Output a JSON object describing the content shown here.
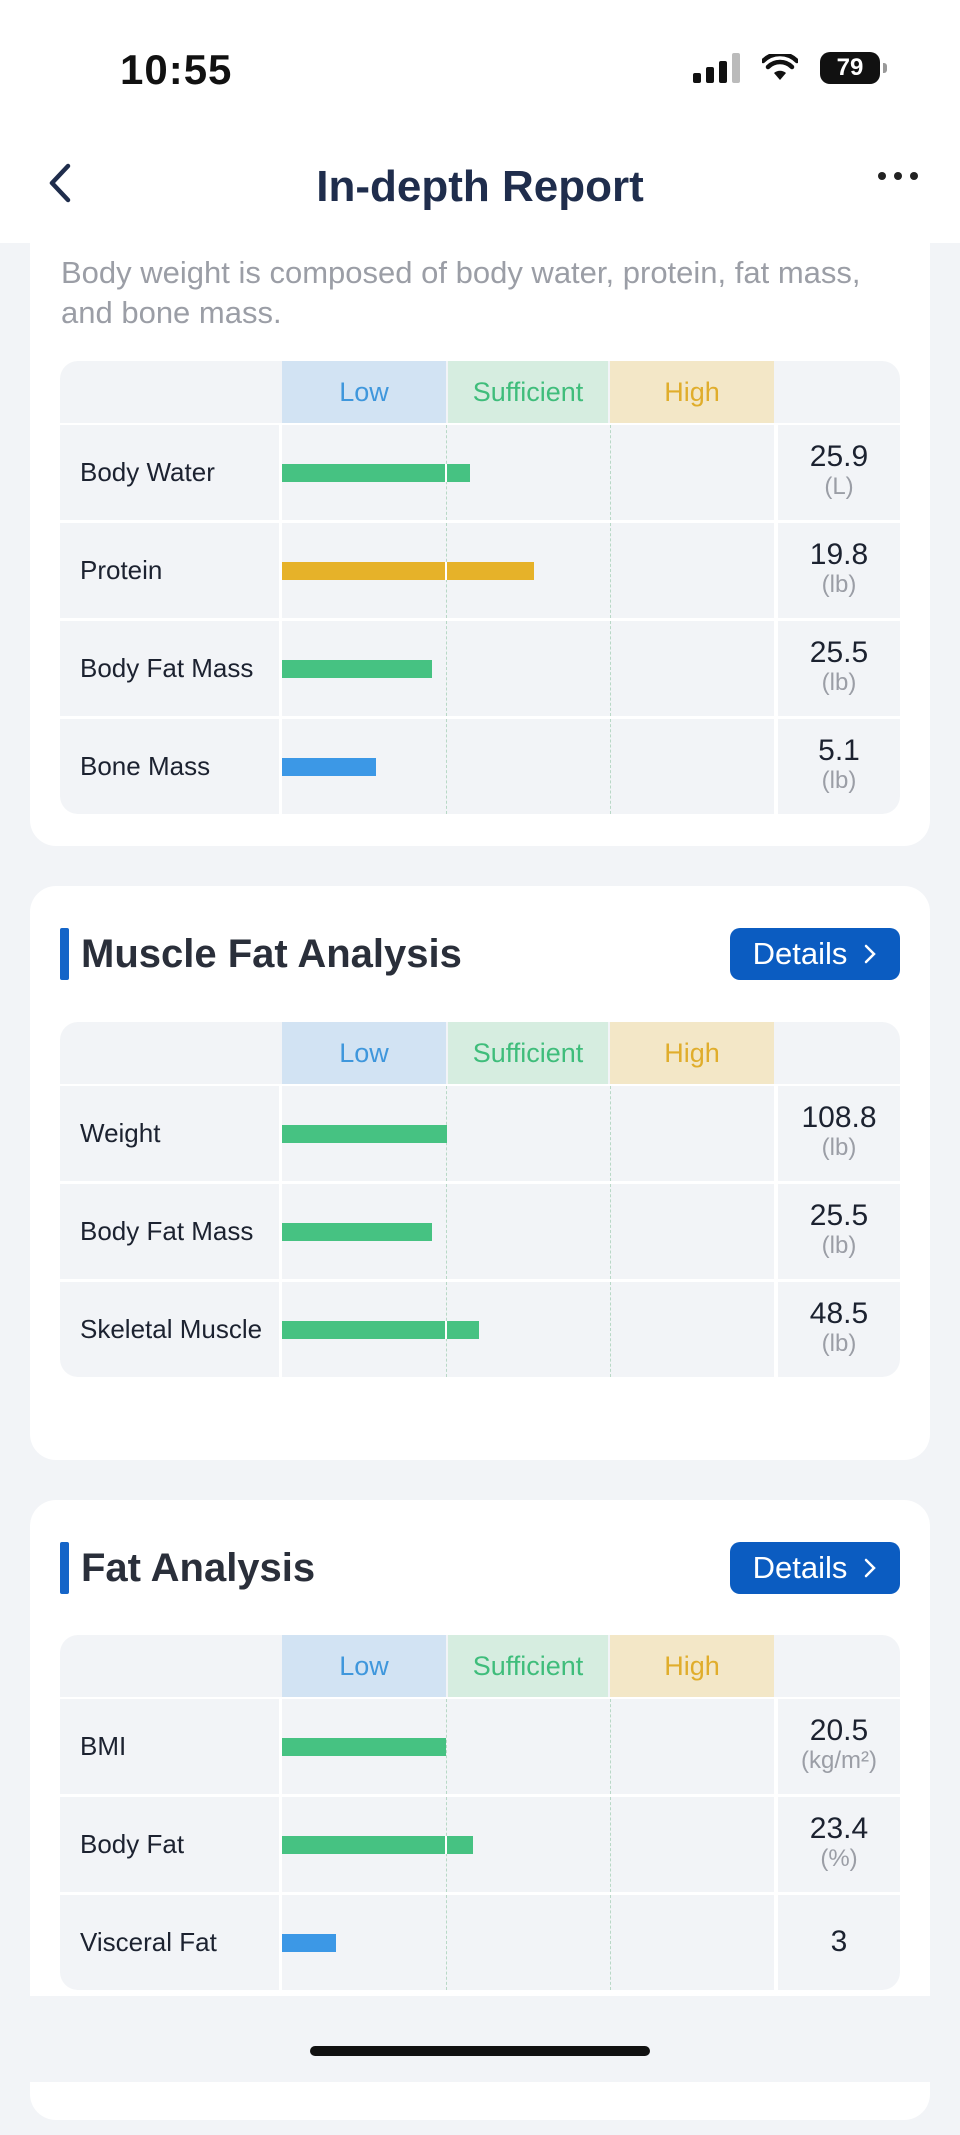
{
  "status_bar": {
    "time": "10:55",
    "battery": "79"
  },
  "header": {
    "title": "In-depth Report"
  },
  "range_labels": {
    "low": "Low",
    "sufficient": "Sufficient",
    "high": "High"
  },
  "colors": {
    "sufficient": "#46c282",
    "high": "#e6b229",
    "low": "#3c98e6",
    "accent": "#0b5cc1"
  },
  "composition": {
    "intro": "Body weight is composed of body water, protein, fat mass, and bone mass.",
    "rows": [
      {
        "label": "Body Water",
        "value": "25.9",
        "unit": "(L)",
        "level": "sufficient",
        "fill_pct": 38.2
      },
      {
        "label": "Protein",
        "value": "19.8",
        "unit": "(lb)",
        "level": "high",
        "fill_pct": 51.2
      },
      {
        "label": "Body Fat Mass",
        "value": "25.5",
        "unit": "(lb)",
        "level": "sufficient",
        "fill_pct": 30.5
      },
      {
        "label": "Bone Mass",
        "value": "5.1",
        "unit": "(lb)",
        "level": "low",
        "fill_pct": 19.1
      }
    ]
  },
  "muscle_fat": {
    "title": "Muscle Fat Analysis",
    "details_label": "Details",
    "rows": [
      {
        "label": "Weight",
        "value": "108.8",
        "unit": "(lb)",
        "level": "sufficient",
        "fill_pct": 33.5
      },
      {
        "label": "Body Fat Mass",
        "value": "25.5",
        "unit": "(lb)",
        "level": "sufficient",
        "fill_pct": 30.5
      },
      {
        "label": "Skeletal Muscle",
        "value": "48.5",
        "unit": "(lb)",
        "level": "sufficient",
        "fill_pct": 40.0
      }
    ]
  },
  "fat_analysis": {
    "title": "Fat Analysis",
    "details_label": "Details",
    "rows": [
      {
        "label": "BMI",
        "value": "20.5",
        "unit": "(kg/m²)",
        "level": "sufficient",
        "fill_pct": 33.3
      },
      {
        "label": "Body Fat",
        "value": "23.4",
        "unit": "(%)",
        "level": "sufficient",
        "fill_pct": 38.8
      },
      {
        "label": "Visceral Fat",
        "value": "3",
        "unit": "",
        "level": "low",
        "fill_pct": 11.0
      }
    ]
  }
}
